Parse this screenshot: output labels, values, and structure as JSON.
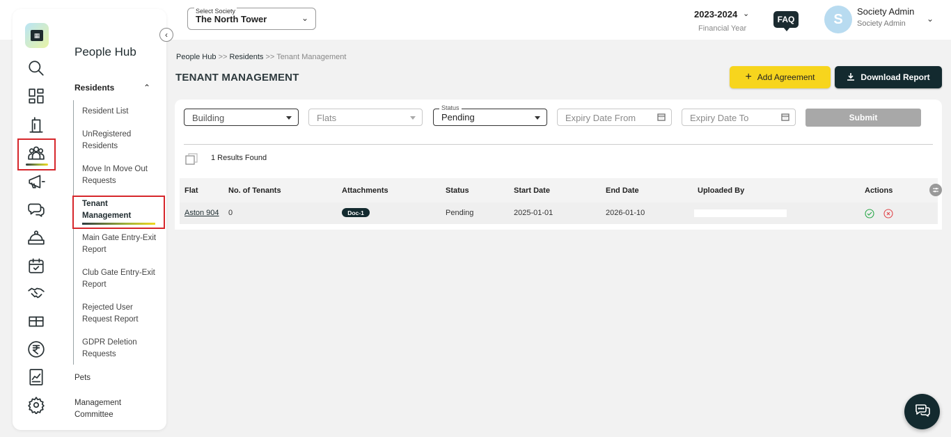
{
  "header": {
    "society_legend": "Select Society",
    "society_value": "The North Tower",
    "year": "2023-2024",
    "year_sub": "Financial Year",
    "faq": "FAQ",
    "avatar_letter": "S",
    "user_name": "Society Admin",
    "user_role": "Society Admin"
  },
  "sidebar": {
    "hub_title": "People Hub",
    "section": "Residents",
    "items": [
      {
        "label": "Resident List"
      },
      {
        "label": "UnRegistered Residents"
      },
      {
        "label": "Move In Move Out Requests"
      },
      {
        "label": "Tenant Management"
      },
      {
        "label": "Main Gate Entry-Exit Report"
      },
      {
        "label": "Club Gate Entry-Exit Report"
      },
      {
        "label": "Rejected User Request Report"
      },
      {
        "label": "GDPR Deletion Requests"
      }
    ],
    "pets": "Pets",
    "management": "Management Committee",
    "rail_icons": [
      "search-icon",
      "dashboard-icon",
      "building-icon",
      "people-icon",
      "megaphone-icon",
      "chat-icon",
      "service-bell-icon",
      "calendar-icon",
      "handshake-icon",
      "gift-icon",
      "rupee-icon",
      "report-chart-icon",
      "settings-icon"
    ]
  },
  "breadcrumb": {
    "part1": "People Hub",
    "sep1": ">>",
    "part2": "Residents",
    "sep2": ">>",
    "current": "Tenant Management"
  },
  "page": {
    "title": "TENANT MANAGEMENT",
    "add_label": "Add Agreement",
    "download_label": "Download Report"
  },
  "filters": {
    "building": "Building",
    "flats": "Flats",
    "status_legend": "Status",
    "status_value": "Pending",
    "expiry_from": "Expiry Date From",
    "expiry_to": "Expiry Date To",
    "submit": "Submit"
  },
  "results": "1 Results Found",
  "table": {
    "columns": [
      "Flat",
      "No. of Tenants",
      "Attachments",
      "Status",
      "Start Date",
      "End Date",
      "Uploaded By",
      "Actions"
    ],
    "rows": [
      {
        "flat": "Aston 904",
        "tenants": "0",
        "attachment": "Doc-1",
        "status": "Pending",
        "start": "2025-01-01",
        "end": "2026-01-10"
      }
    ]
  },
  "colors": {
    "accent_yellow": "#f7d51d",
    "dark": "#132a2f",
    "highlight_red": "#d6262b"
  }
}
